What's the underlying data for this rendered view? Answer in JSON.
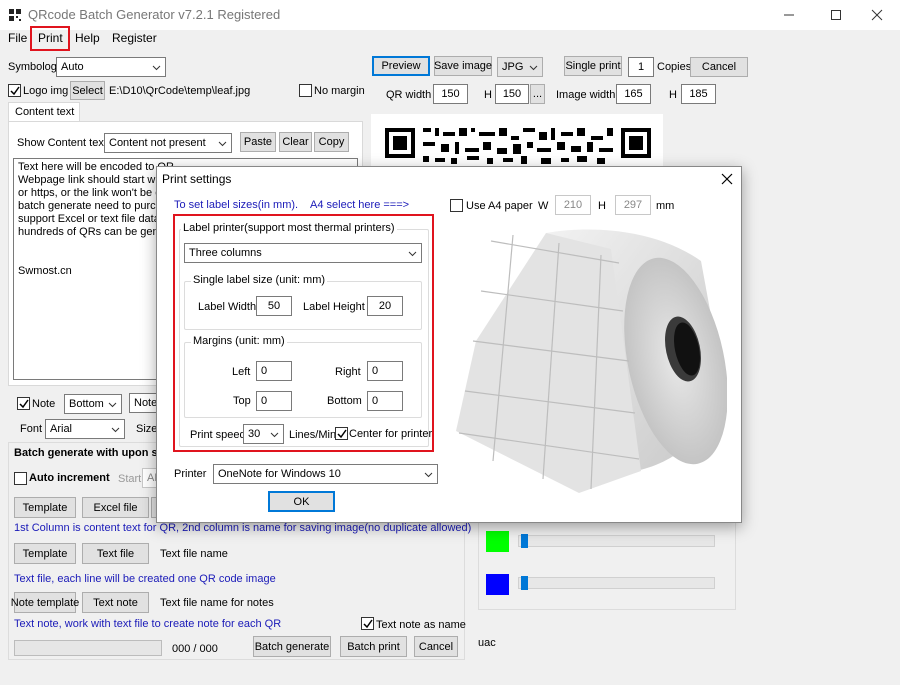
{
  "window": {
    "title": "QRcode Batch Generator v7.2.1 Registered"
  },
  "menu": {
    "file": "File",
    "print": "Print",
    "help": "Help",
    "register": "Register"
  },
  "toolbar": {
    "symbology_label": "Symbology",
    "symbology_value": "Auto",
    "preview": "Preview",
    "save_image": "Save image",
    "format": "JPG",
    "single_print": "Single print",
    "copies_value": "1",
    "copies_label": "Copies",
    "cancel": "Cancel"
  },
  "logo": {
    "label": "Logo img",
    "select": "Select",
    "path": "E:\\D10\\QrCode\\temp\\leaf.jpg",
    "no_margin": "No margin"
  },
  "sizes": {
    "qr_width_label": "QR width",
    "qr_width": "150",
    "h_label": "H",
    "qr_height": "150",
    "more": "...",
    "image_width_label": "Image width",
    "image_width": "165",
    "image_height": "185"
  },
  "content": {
    "tab": "Content text",
    "show_label": "Show Content text",
    "show_value": "Content not present",
    "paste": "Paste",
    "clear": "Clear",
    "copy": "Copy",
    "text_lines": [
      "Text here will be encoded to QR",
      "Webpage link should start with",
      "or https, or the link won't be op",
      "batch generate need to purcha",
      "support Excel or text file data te",
      "hundreds of QRs can be gener",
      "",
      "",
      "Swmost.cn"
    ]
  },
  "note": {
    "label": "Note",
    "position": "Bottom",
    "notes": "Notes",
    "font_label": "Font",
    "font_value": "Arial",
    "size_label": "Size"
  },
  "batch": {
    "title": "Batch generate with upon se",
    "auto_increment": "Auto increment",
    "start_label": "Start",
    "start_value": "AB",
    "template1": "Template",
    "excel_file": "Excel file",
    "excel_hint": "1st Column is content text for QR, 2nd column is name for saving image(no duplicate allowed)",
    "template2": "Template",
    "text_file": "Text file",
    "text_file_name": "Text file name",
    "text_hint": "Text file, each line will be created one QR code image",
    "note_template": "Note template",
    "text_note": "Text note",
    "notes_file_name": "Text file name for notes",
    "note_hint": "Text note, work with text file to create note for each QR",
    "text_note_as_name": "Text note as name",
    "progress_text": "000 / 000",
    "batch_generate": "Batch generate",
    "batch_print": "Batch print",
    "cancel": "Cancel",
    "uac": "uac"
  },
  "colors": {
    "green": "#00ff00",
    "blue": "#0000ff",
    "highlight": "#e0141e"
  },
  "dialog": {
    "title": "Print settings",
    "set_label_hint": "To set label sizes(in mm).",
    "a4_hint": "A4 select here ===>",
    "use_a4": "Use A4 paper",
    "w_label": "W",
    "w_value": "210",
    "h_label": "H",
    "h_value": "297",
    "mm": "mm",
    "label_printer_title": "Label printer(support most thermal printers)",
    "columns_value": "Three columns",
    "single_size_title": "Single label size (unit: mm)",
    "label_width_label": "Label Width",
    "label_width": "50",
    "label_height_label": "Label Height",
    "label_height": "20",
    "margins_title": "Margins (unit: mm)",
    "left_label": "Left",
    "left": "0",
    "right_label": "Right",
    "right": "0",
    "top_label": "Top",
    "top": "0",
    "bottom_label": "Bottom",
    "bottom": "0",
    "print_speed_label": "Print speed",
    "print_speed": "30",
    "lines_min": "Lines/Min",
    "center_for_printer": "Center for printer",
    "printer_label": "Printer",
    "printer_value": "OneNote for Windows 10",
    "ok": "OK"
  }
}
